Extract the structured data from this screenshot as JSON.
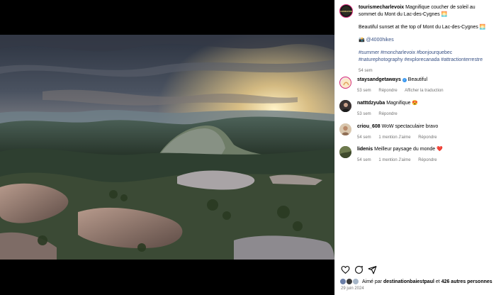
{
  "post": {
    "username": "tourismecharlevoix",
    "avatar_text": "CHARLEVOIX",
    "caption_title": "Magnifique coucher de soleil au sommet du Mont du Lac-des-Cygnes 🌅",
    "caption_english": "Beautiful sunset at the top of Mont du Lac-des-Cygnes 🌅",
    "camera_emoji": "📸",
    "credit_handle": "@4000hikes",
    "hashtags": "#summer #moncharlevoix #bonjourquebec #naturephotography #explorecanada #attractionterrestre",
    "time_ago": "54 sem"
  },
  "comments": [
    {
      "username": "staysandgetaways",
      "verified": true,
      "text": "Beautiful",
      "time": "53 sem",
      "reply_label": "Répondre",
      "translate_label": "Afficher la traduction",
      "likes_label": ""
    },
    {
      "username": "natttdzyuba",
      "verified": false,
      "text": "Magnifique 😍",
      "time": "53 sem",
      "reply_label": "Répondre",
      "translate_label": "",
      "likes_label": ""
    },
    {
      "username": "criou_608",
      "verified": false,
      "text": "WoW spectaculaire bravo",
      "time": "54 sem",
      "reply_label": "Répondre",
      "translate_label": "",
      "likes_label": "1 mention J'aime"
    },
    {
      "username": "lidenis",
      "verified": false,
      "text": "Meilleur paysage du monde ❤️",
      "time": "54 sem",
      "reply_label": "Répondre",
      "translate_label": "",
      "likes_label": "1 mention J'aime"
    }
  ],
  "actions": {
    "like_icon": "heart-icon",
    "comment_icon": "comment-icon",
    "share_icon": "share-icon"
  },
  "likes": {
    "prefix": "Aimé par",
    "user": "destinationbaiestpaul",
    "connector": "et",
    "others": "426 autres personnes"
  },
  "date": "29 juin 2024",
  "colors": {
    "link": "#385185",
    "meta": "#737373",
    "story_ring": "#d62976"
  }
}
